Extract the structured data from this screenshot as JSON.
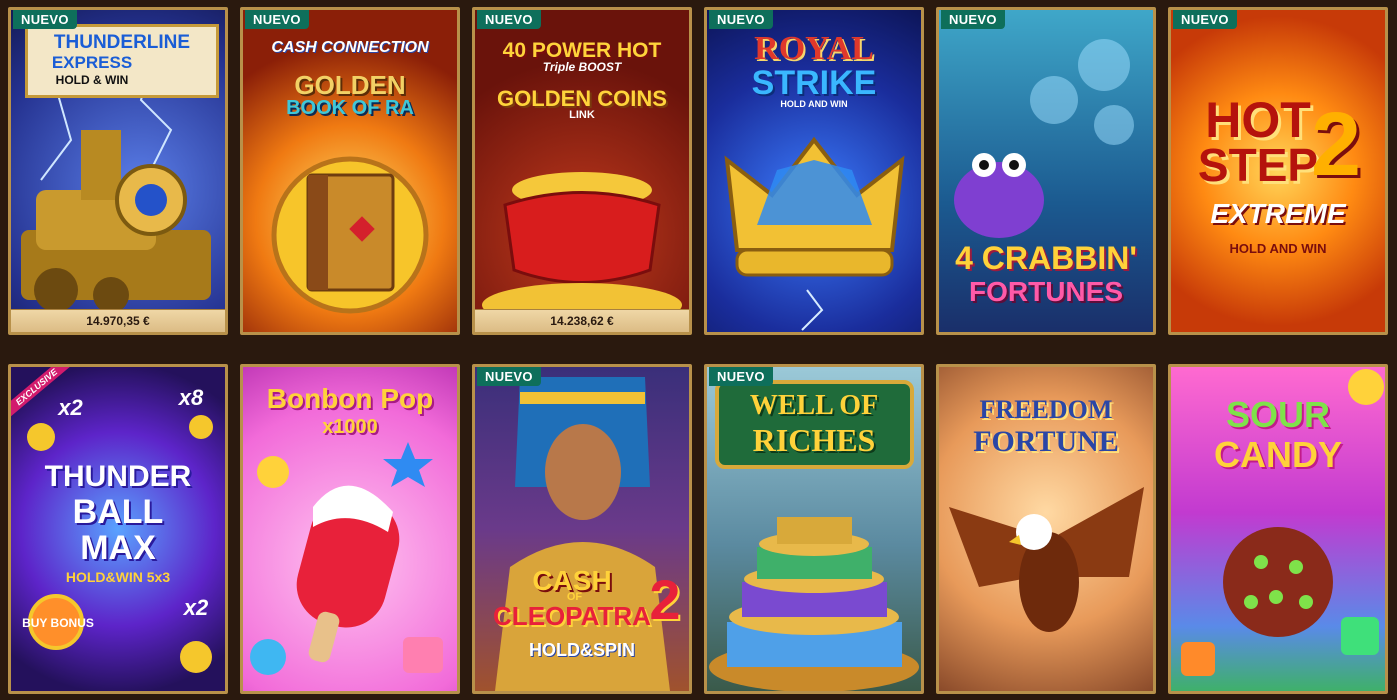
{
  "labels": {
    "new_badge": "NUEVO",
    "exclusive_badge": "EXCLUSIVE"
  },
  "games": [
    {
      "title_line1": "THUNDERLINE",
      "title_line2": "EXPRESS",
      "subtitle": "HOLD & WIN",
      "jackpot": "14.970,35 €"
    },
    {
      "title_top": "CASH CONNECTION",
      "title_line1": "GOLDEN",
      "title_line2": "BOOK OF RA"
    },
    {
      "title_line1": "40 POWER HOT",
      "title_small": "Triple BOOST",
      "title_line2": "GOLDEN COINS",
      "title_tag": "LINK",
      "jackpot": "14.238,62 €"
    },
    {
      "title_line1": "ROYAL",
      "title_line2": "STRIKE",
      "subtitle": "HOLD AND WIN"
    },
    {
      "title_line1": "4 CRABBIN'",
      "title_line2": "FORTUNES"
    },
    {
      "title_line1": "HOT",
      "title_line2": "STEP",
      "title_num": "2",
      "title_line3": "EXTREME",
      "subtitle": "HOLD AND WIN"
    },
    {
      "title_line1": "THUNDER",
      "title_line2": "BALL",
      "title_line3": "MAX",
      "subtitle": "HOLD&WIN 5x3",
      "mult_a": "x2",
      "mult_b": "x8",
      "mult_c": "x2",
      "buy": "BUY BONUS"
    },
    {
      "title_line1": "Bonbon Pop",
      "subtitle": "x1000"
    },
    {
      "title_line1": "CASH",
      "title_small": "OF",
      "title_line2": "CLEOPATRA",
      "title_num": "2",
      "subtitle": "HOLD&SPIN"
    },
    {
      "title_line1": "WELL OF",
      "title_line2": "RICHES"
    },
    {
      "title_line1": "FREEDOM",
      "title_line2": "FORTUNE"
    },
    {
      "title_line1": "SOUR",
      "title_line2": "CANDY"
    }
  ],
  "colors": {
    "page_bg": "#2a190e",
    "frame": "#b8914a",
    "badge_bg": "#0e6f5b",
    "jackpot_bg": "#e6c995"
  }
}
